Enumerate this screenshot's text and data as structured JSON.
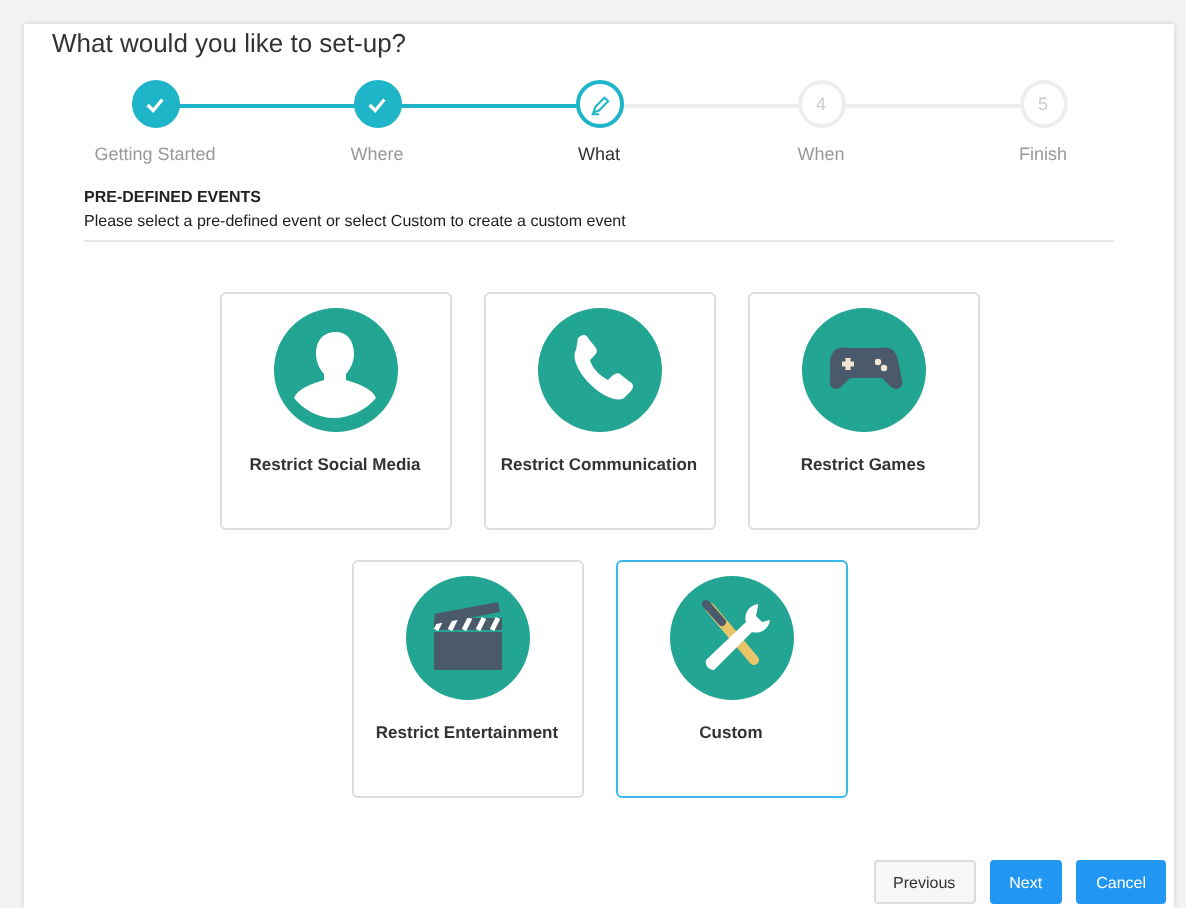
{
  "title": "What would you like to set-up?",
  "steps": [
    {
      "label": "Getting Started",
      "completed": true,
      "selected": false
    },
    {
      "label": "Where",
      "completed": true,
      "selected": false
    },
    {
      "label": "What",
      "completed": false,
      "selected": true
    },
    {
      "label": "When",
      "completed": false,
      "selected": false,
      "number": "4"
    },
    {
      "label": "Finish",
      "completed": false,
      "selected": false,
      "number": "5"
    }
  ],
  "section": {
    "heading": "PRE-DEFINED EVENTS",
    "description": "Please select a pre-defined event or select Custom to create a custom event"
  },
  "event_rows": [
    [
      {
        "label": "Restrict Social Media",
        "kind": "person",
        "selected": false
      },
      {
        "label": "Restrict Communication",
        "kind": "phone",
        "selected": false
      },
      {
        "label": "Restrict Games",
        "kind": "gamepad",
        "selected": false
      }
    ],
    [
      {
        "label": "Restrict Entertainment",
        "kind": "clapper",
        "selected": false
      },
      {
        "label": "Custom",
        "kind": "tools",
        "selected": true
      }
    ]
  ],
  "buttons": [
    {
      "label": "Previous",
      "kind": "secondary"
    },
    {
      "label": "Next",
      "kind": "primary"
    },
    {
      "label": "Cancel",
      "kind": "primary"
    }
  ]
}
